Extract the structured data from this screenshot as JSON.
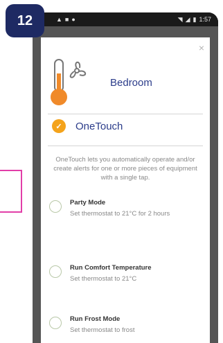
{
  "badge": {
    "number": "12"
  },
  "status_bar": {
    "left_icons": [
      "notification-icon",
      "warning-icon",
      "settings-icon"
    ],
    "right_text": "1:57"
  },
  "card": {
    "close_label": "×",
    "room_name": "Bedroom",
    "onetouch": {
      "title": "OneTouch",
      "description": "OneTouch lets you automatically operate and/or create alerts for one or more pieces of equipment with a single tap."
    },
    "actions": [
      {
        "title": "Party Mode",
        "subtitle": "Set thermostat to 21°C for 2 hours"
      },
      {
        "title": "Run Comfort Temperature",
        "subtitle": "Set thermostat to 21°C"
      },
      {
        "title": "Run Frost Mode",
        "subtitle": "Set thermostat to frost"
      }
    ]
  },
  "colors": {
    "accent_blue": "#2b3c8a",
    "onetouch_orange": "#f4a31b",
    "badge_navy": "#1e2a63",
    "highlight_pink": "#e23ea8"
  }
}
